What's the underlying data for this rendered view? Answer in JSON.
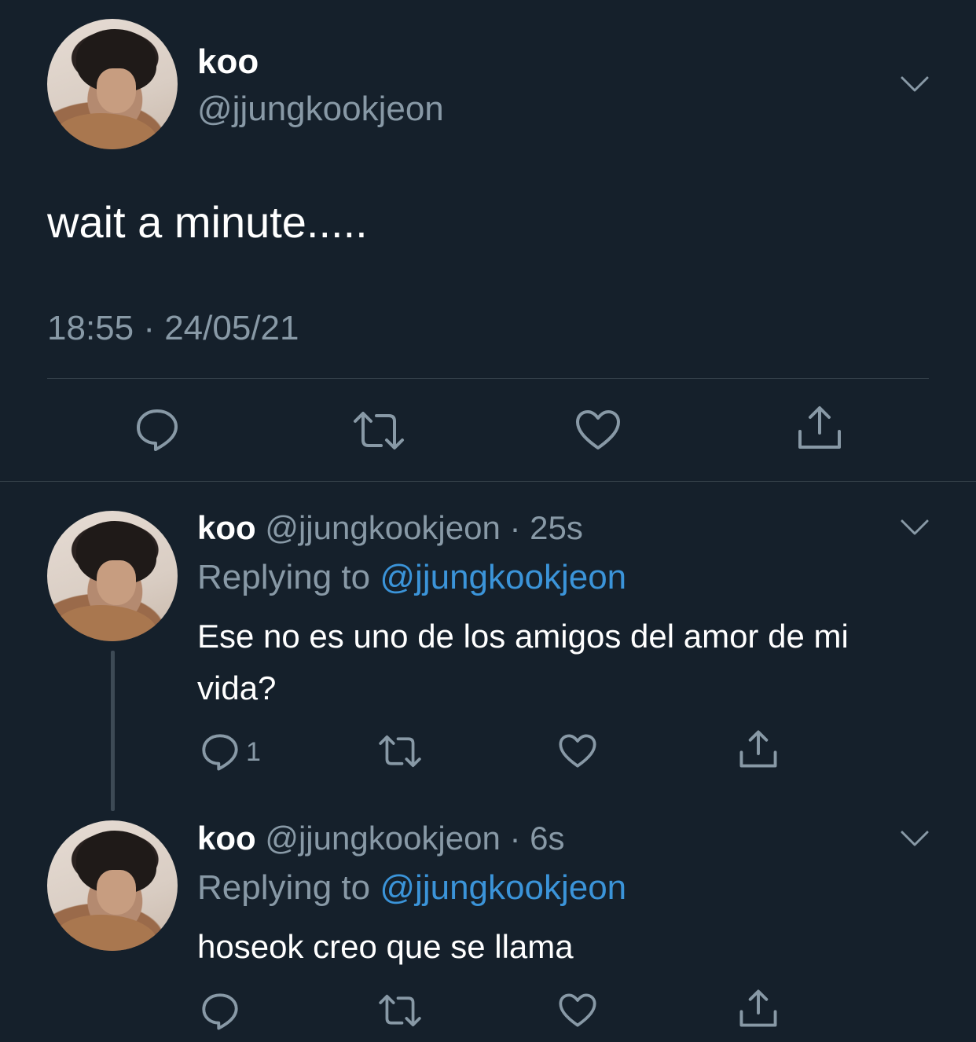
{
  "main_tweet": {
    "display_name": "koo",
    "handle": "@jjungkookjeon",
    "text": "wait a minute.....",
    "timestamp": "18:55 · 24/05/21",
    "actions": [
      "reply-icon",
      "retweet-icon",
      "like-icon",
      "share-icon"
    ]
  },
  "replies": [
    {
      "display_name": "koo",
      "handle_time": "@jjungkookjeon · 25s",
      "replying_prefix": "Replying to",
      "replying_handle": "@jjungkookjeon",
      "text": "Ese no es uno de los amigos del amor de mi vida?",
      "reply_count": "1"
    },
    {
      "display_name": "koo",
      "handle_time": "@jjungkookjeon · 6s",
      "replying_prefix": "Replying to",
      "replying_handle": "@jjungkookjeon",
      "text": "hoseok creo que se llama",
      "reply_count": ""
    }
  ],
  "colors": {
    "background": "#15202b",
    "secondary_text": "#8899a6",
    "link": "#3b94d9",
    "divider": "#38444d"
  }
}
